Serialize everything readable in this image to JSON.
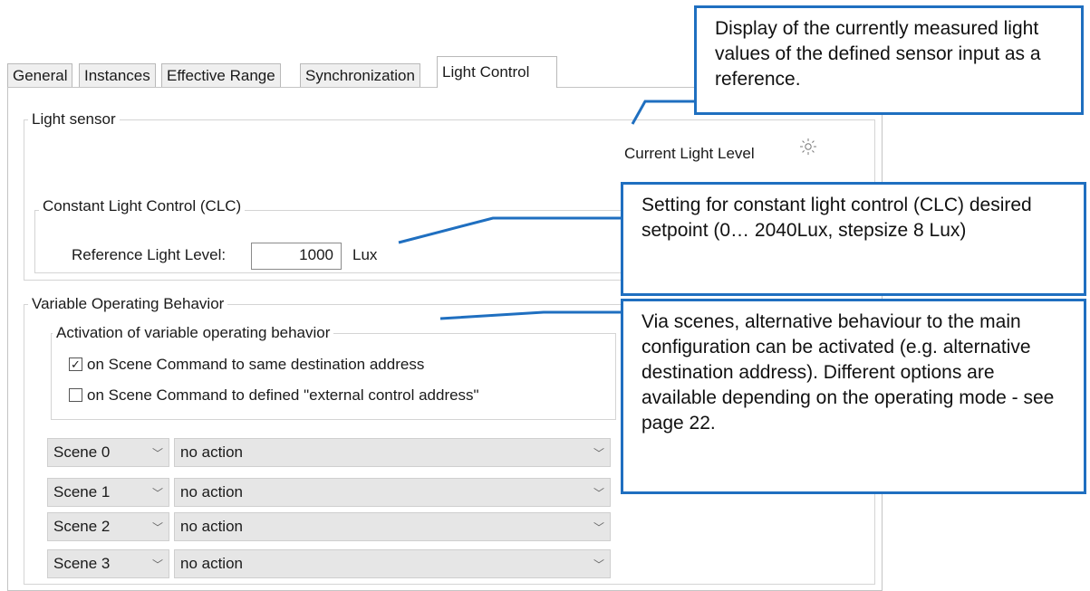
{
  "tabs": [
    {
      "label": "General",
      "active": false
    },
    {
      "label": "Instances",
      "active": false
    },
    {
      "label": "Effective Range",
      "active": false
    },
    {
      "label": "Synchronization",
      "active": false
    },
    {
      "label": "Light Control",
      "active": true
    }
  ],
  "light_sensor": {
    "legend": "Light sensor",
    "current_level_label": "Current Light Level",
    "icon": "sun-icon"
  },
  "clc": {
    "legend": "Constant Light Control (CLC)",
    "reference_label": "Reference Light Level:",
    "reference_value": "1000",
    "unit": "Lux"
  },
  "variable_behavior": {
    "legend": "Variable Operating Behavior",
    "activation": {
      "legend": "Activation of variable operating behavior",
      "options": [
        {
          "label": "on Scene Command to same destination address",
          "checked": true
        },
        {
          "label": "on Scene Command to defined \"external control address\"",
          "checked": false
        }
      ]
    },
    "scenes": [
      {
        "scene": "Scene 0",
        "action": "no action"
      },
      {
        "scene": "Scene 1",
        "action": "no action"
      },
      {
        "scene": "Scene 2",
        "action": "no action"
      },
      {
        "scene": "Scene 3",
        "action": "no action"
      }
    ]
  },
  "callouts": {
    "light_values": "Display of the currently measured light values of the defined sensor input as a reference.",
    "clc_setting": "Setting for constant light control (CLC) desired setpoint (0… 2040Lux, stepsize 8 Lux)",
    "scenes": "Via scenes, alternative behaviour to the main configuration can be activated (e.g. alternative destination address). Different options are available depending on the operating mode - see page 22."
  },
  "colors": {
    "callout_border": "#1f6fc0",
    "combo_background": "#e6e6e6"
  }
}
